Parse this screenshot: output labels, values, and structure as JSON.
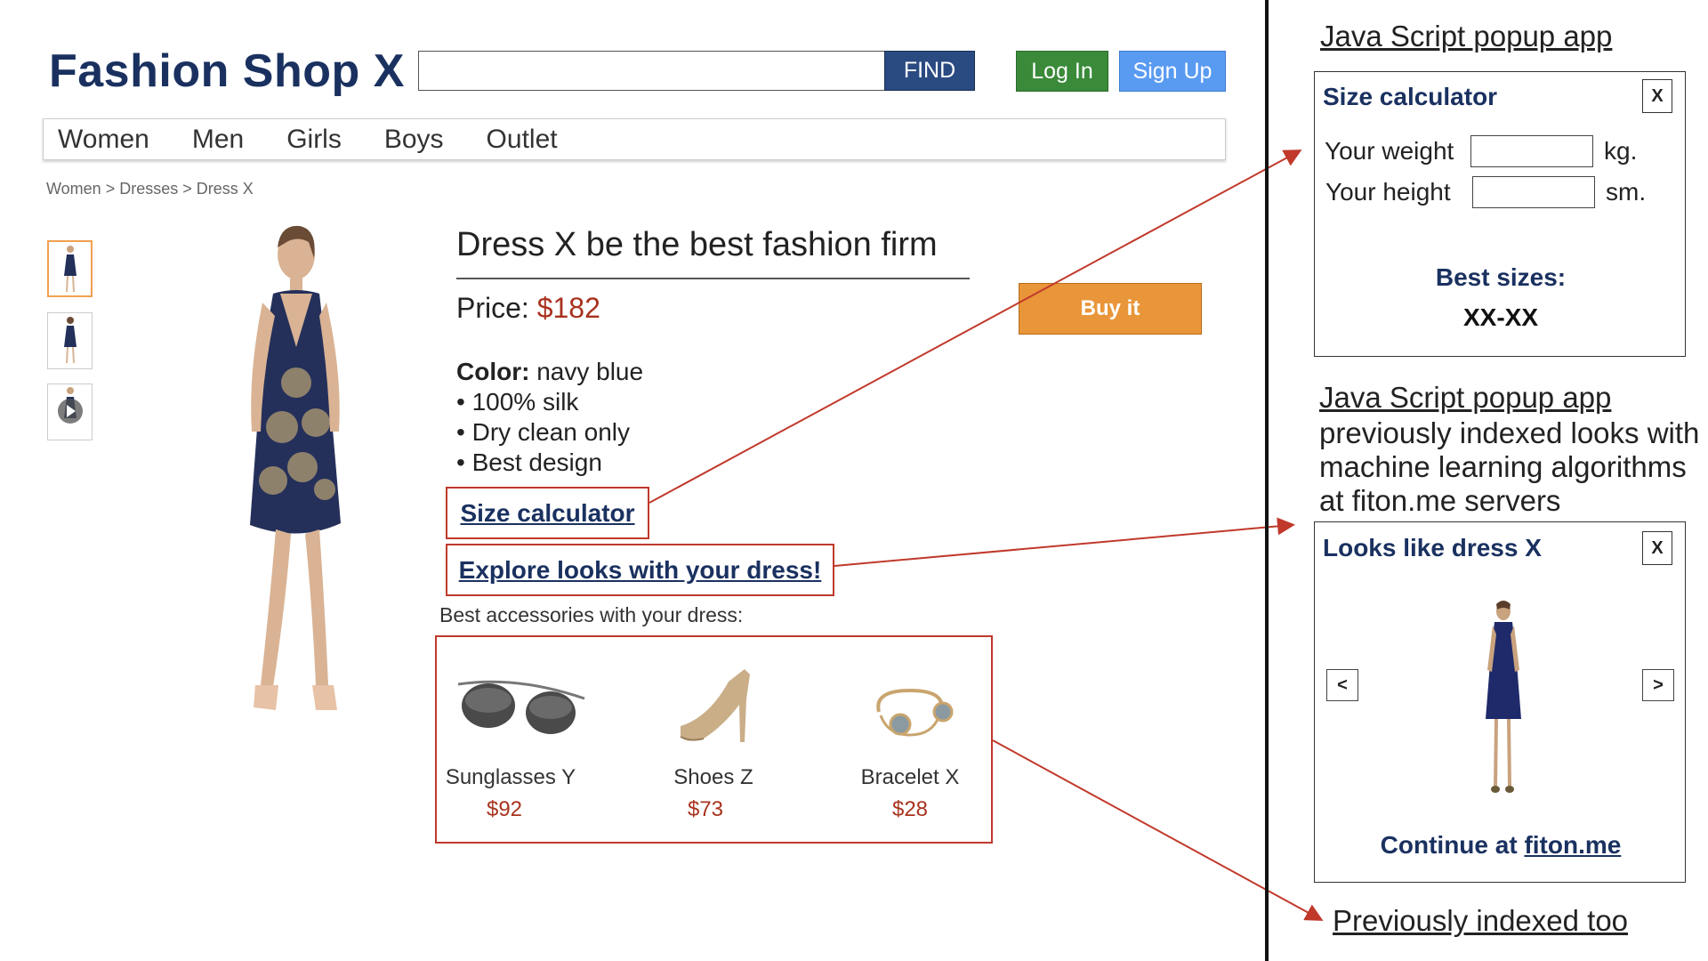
{
  "header": {
    "logo": "Fashion Shop X",
    "search": {
      "value": "",
      "placeholder": ""
    },
    "find_label": "FIND",
    "login_label": "Log In",
    "signup_label": "Sign Up"
  },
  "nav": {
    "items": [
      "Women",
      "Men",
      "Girls",
      "Boys",
      "Outlet"
    ]
  },
  "breadcrumb": "Women > Dresses > Dress X",
  "product": {
    "title": "Dress X be the best fashion firm",
    "price_label": "Price: ",
    "price_value": "$182",
    "buy_label": "Buy it",
    "color_label": "Color:",
    "color_value": " navy blue",
    "bullets": [
      "100% silk",
      "Dry clean only",
      "Best design"
    ],
    "size_calc_link": "Size calculator",
    "explore_link": "Explore looks with your dress!",
    "accessories_caption": "Best accessories with your dress:",
    "accessories": [
      {
        "name": "Sunglasses Y",
        "price": "$92",
        "icon": "sunglasses-icon"
      },
      {
        "name": "Shoes Z",
        "price": "$73",
        "icon": "shoe-icon"
      },
      {
        "name": "Bracelet X",
        "price": "$28",
        "icon": "bracelet-icon"
      }
    ]
  },
  "right_panel": {
    "section1_heading": "Java Script popup app",
    "size_popup": {
      "title": "Size calculator",
      "close": "X",
      "weight_label": "Your weight",
      "weight_unit": "kg.",
      "height_label": "Your height",
      "height_unit": "sm.",
      "best_label": "Best sizes:",
      "best_value": "XX-XX"
    },
    "section2_heading": "Java Script popup app",
    "section2_text": [
      "previously indexed looks with",
      "machine learning algorithms",
      "at fiton.me servers"
    ],
    "looks_popup": {
      "title": "Looks like dress X",
      "close": "X",
      "prev": "<",
      "next": ">",
      "continue_prefix": "Continue at ",
      "continue_link": "fiton.me"
    },
    "section3_heading": "Previously indexed too"
  },
  "colors": {
    "brand_navy": "#1a3160",
    "find_button": "#2a4a82",
    "login_button": "#3a8a3a",
    "signup_button": "#5a9bf2",
    "buy_button": "#e9963a",
    "price_red": "#a8321e",
    "highlight_red": "#c0392b"
  }
}
